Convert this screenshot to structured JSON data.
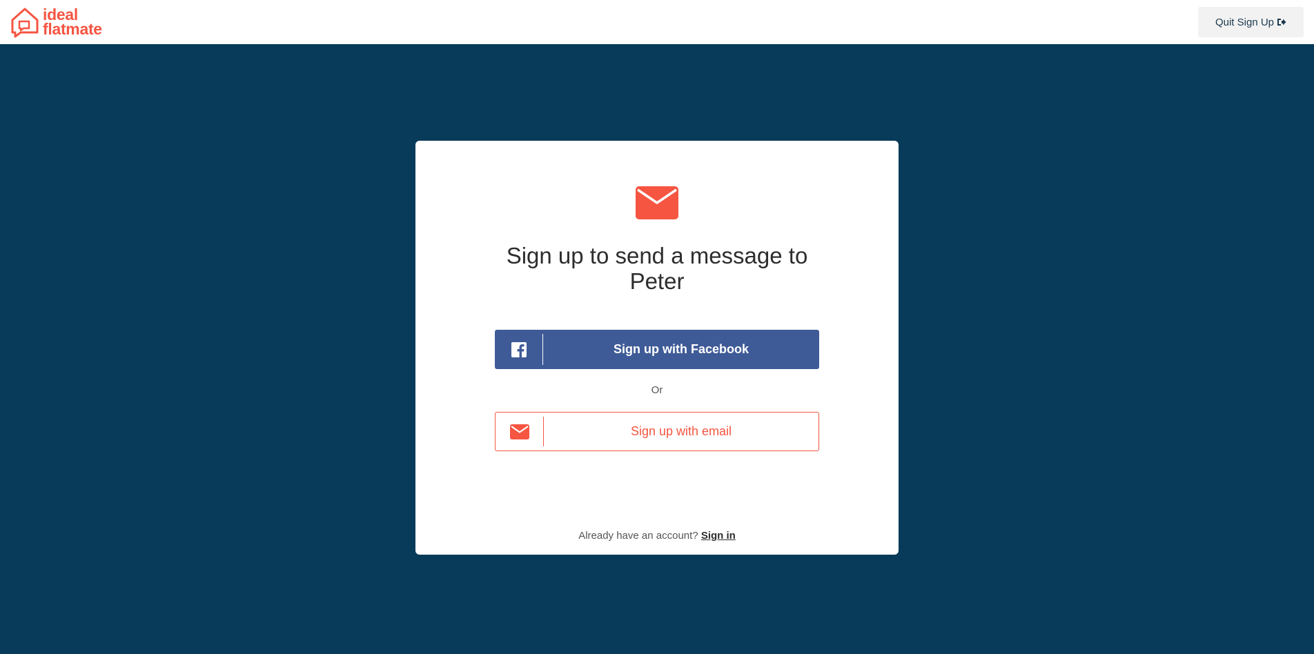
{
  "header": {
    "logo": {
      "line1": "ideal",
      "line2": "flatmate",
      "icon": "house-chat-logo-icon"
    },
    "quit_label": "Quit Sign Up",
    "quit_icon": "sign-out-icon"
  },
  "card": {
    "icon": "envelope-icon",
    "title": "Sign up to send a message to Peter",
    "facebook_label": "Sign up with Facebook",
    "facebook_icon": "facebook-icon",
    "or_label": "Or",
    "email_label": "Sign up with email",
    "email_icon": "envelope-icon",
    "signin_prompt": "Already have an account?",
    "signin_link": "Sign in"
  },
  "colors": {
    "brand_coral": "#f55541",
    "background_navy": "#083b5a",
    "facebook_blue": "#3f5b97"
  }
}
